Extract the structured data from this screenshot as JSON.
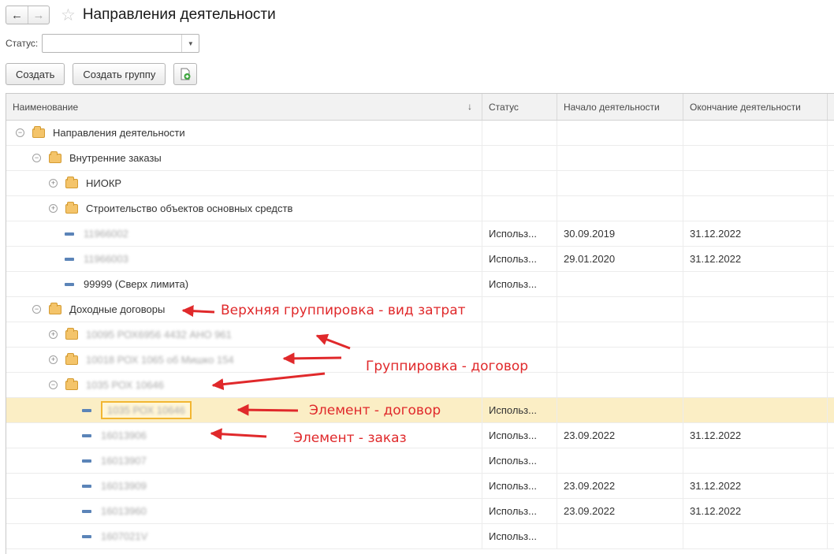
{
  "header": {
    "back": "←",
    "forward": "→",
    "title": "Направления деятельности"
  },
  "filter": {
    "status_label": "Статус:",
    "status_value": ""
  },
  "toolbar": {
    "create": "Создать",
    "create_group": "Создать группу"
  },
  "columns": {
    "name": "Наименование",
    "sort": "↓",
    "status": "Статус",
    "start": "Начало деятельности",
    "end": "Окончание деятельности"
  },
  "rows": [
    {
      "name": "Направления деятельности",
      "status": "",
      "start": "",
      "end": ""
    },
    {
      "name": "Внутренние заказы",
      "status": "",
      "start": "",
      "end": ""
    },
    {
      "name": "НИОКР",
      "status": "",
      "start": "",
      "end": ""
    },
    {
      "name": "Строительство объектов основных средств",
      "status": "",
      "start": "",
      "end": ""
    },
    {
      "name": "11966002",
      "status": "Использ...",
      "start": "30.09.2019",
      "end": "31.12.2022"
    },
    {
      "name": "11966003",
      "status": "Использ...",
      "start": "29.01.2020",
      "end": "31.12.2022"
    },
    {
      "name": "99999 (Сверх лимита)",
      "status": "Использ...",
      "start": "",
      "end": ""
    },
    {
      "name": "Доходные договоры",
      "status": "",
      "start": "",
      "end": ""
    },
    {
      "name": "10095 РОХ6956 4432 АНО 961",
      "status": "",
      "start": "",
      "end": ""
    },
    {
      "name": "10018 РОХ 1065 об Мишко 154",
      "status": "",
      "start": "",
      "end": ""
    },
    {
      "name": "1035 РОХ 10646",
      "status": "",
      "start": "",
      "end": ""
    },
    {
      "name": "1035 РОХ 10646",
      "status": "Использ...",
      "start": "",
      "end": ""
    },
    {
      "name": "16013906",
      "status": "Использ...",
      "start": "23.09.2022",
      "end": "31.12.2022"
    },
    {
      "name": "16013907",
      "status": "Использ...",
      "start": "",
      "end": ""
    },
    {
      "name": "16013909",
      "status": "Использ...",
      "start": "23.09.2022",
      "end": "31.12.2022"
    },
    {
      "name": "16013960",
      "status": "Использ...",
      "start": "23.09.2022",
      "end": "31.12.2022"
    },
    {
      "name": "1607021V",
      "status": "Использ...",
      "start": "",
      "end": ""
    }
  ],
  "annotations": {
    "top_group": "Верхняя группировка - вид затрат",
    "group_contract": "Группировка - договор",
    "element_contract": "Элемент - договор",
    "element_order": "Элемент - заказ"
  },
  "colors": {
    "annotation": "#e0292b",
    "selected_row": "#fbeec5",
    "folder": "#f4c46a"
  }
}
